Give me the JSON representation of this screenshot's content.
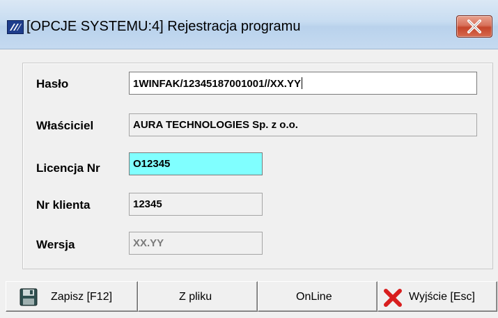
{
  "window": {
    "title": "[OPCJE SYSTEMU:4]  Rejestracja programu",
    "app_icon": "winfak-logo-icon",
    "close_icon": "close-icon"
  },
  "form": {
    "haslo": {
      "label": "Hasło",
      "value": "1WINFAK/12345187001001//XX.YY"
    },
    "wlasciciel": {
      "label": "Właściciel",
      "value": "AURA TECHNOLOGIES Sp. z o.o."
    },
    "licencja": {
      "label": "Licencja Nr",
      "value": "O12345",
      "highlight_color": "#80ffff"
    },
    "nr_klienta": {
      "label": "Nr klienta",
      "value": "12345"
    },
    "wersja": {
      "label": "Wersja",
      "value": "XX.YY"
    }
  },
  "buttons": {
    "zapisz": {
      "label": "Zapisz  [F12]",
      "icon": "floppy-disk-icon"
    },
    "z_pliku": {
      "label": "Z pliku"
    },
    "online": {
      "label": "OnLine"
    },
    "wyjscie": {
      "label": "Wyjście  [Esc]",
      "icon": "red-x-icon"
    }
  }
}
